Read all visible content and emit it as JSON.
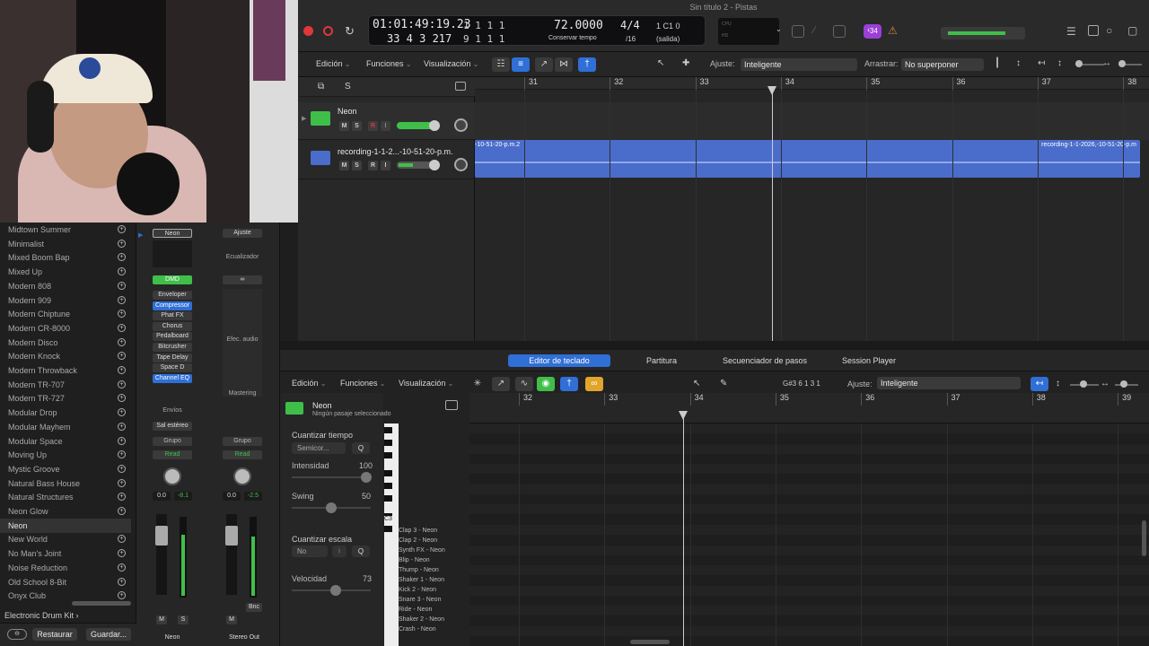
{
  "window": {
    "title": "Sin título 2 - Pistas"
  },
  "lcd": {
    "time": "01:01:49:19.23",
    "time_sub": "1 1 1 1",
    "bars": "33 4 3 217",
    "bars_sub": "9 1 1 1",
    "tempo": "72.0000",
    "tempo_label": "Conservar tempo",
    "sig": "4/4",
    "div": "/16",
    "key": "1 C1 0",
    "key_label": "(salida)",
    "cpu": "CPU",
    "hd": "HD"
  },
  "badge": {
    "count": "¹34"
  },
  "toolbar": {
    "edicion": "Edición",
    "funciones": "Funciones",
    "visualizacion": "Visualización",
    "ajuste_label": "Ajuste:",
    "ajuste_value": "Inteligente",
    "arrastrar_label": "Arrastrar:",
    "arrastrar_value": "No superponer"
  },
  "ruler": [
    "31",
    "32",
    "33",
    "34",
    "35",
    "36",
    "37",
    "38"
  ],
  "tracks": [
    {
      "name": "Neon",
      "m": "M",
      "s": "S",
      "r": "R",
      "i": "I"
    },
    {
      "name": "recording-1-1-2...-10-51-20-p.m.",
      "m": "M",
      "s": "S",
      "r": "R",
      "i": "I"
    }
  ],
  "region": {
    "left_name": "-10-51-20-p.m.2",
    "right_name": "recording-1-1-2026,-10-51-20-p.m"
  },
  "library": {
    "items": [
      "Midtown Summer",
      "Minimalist",
      "Mixed Boom Bap",
      "Mixed Up",
      "Modern 808",
      "Modern 909",
      "Modern Chiptune",
      "Modern CR-8000",
      "Modern Disco",
      "Modern Knock",
      "Modern Throwback",
      "Modern TR-707",
      "Modern TR-727",
      "Modular Drop",
      "Modular Mayhem",
      "Modular Space",
      "Moving Up",
      "Mystic Groove",
      "Natural Bass House",
      "Natural Structures",
      "Neon Glow",
      "Neon",
      "New World",
      "No Man's Joint",
      "Noise Reduction",
      "Old School 8-Bit",
      "Onyx Club"
    ],
    "selected": "Neon",
    "footer": "Electronic Drum Kit",
    "restore": "Restaurar",
    "save": "Guardar..."
  },
  "mixer": {
    "strip1": {
      "setting": "Neon",
      "dmd": "DMD",
      "plugins": [
        "Enveloper",
        "Compressor",
        "Phat FX",
        "Chorus",
        "Pedalboard",
        "Bitcrusher",
        "Tape Delay",
        "Space D",
        "Channel EQ"
      ],
      "envios": "Envíos",
      "output": "Sal estéreo",
      "group": "Grupo",
      "read": "Read",
      "pan": "0.0",
      "level": "-8.1",
      "m": "M",
      "s": "S",
      "name": "Neon"
    },
    "strip2": {
      "setting": "Ajuste",
      "eq": "Ecualizador",
      "efec": "Efec. audio",
      "mastering": "Mastering",
      "group": "Grupo",
      "read": "Read",
      "pan": "0.0",
      "level": "-2.5",
      "bnc": "Bnc",
      "m": "M",
      "name": "Stereo Out"
    }
  },
  "editor": {
    "tabs": [
      "Editor de teclado",
      "Partitura",
      "Secuenciador de pasos",
      "Session Player"
    ],
    "edicion": "Edición",
    "funciones": "Funciones",
    "visualizacion": "Visualización",
    "position": "G#3  6 1 3 1",
    "ajuste_label": "Ajuste:",
    "ajuste_value": "Inteligente",
    "ruler": [
      "32",
      "33",
      "34",
      "35",
      "36",
      "37",
      "38",
      "39"
    ],
    "region_name": "Neon",
    "region_sub": "Ningún pasaje seleccionado",
    "quant_time": "Cuantizar tiempo",
    "quant_value": "Semicor...",
    "q": "Q",
    "intensidad": "Intensidad",
    "intensidad_val": "100",
    "swing": "Swing",
    "swing_val": "50",
    "quant_scale": "Cuantizar escala",
    "scale_value": "No",
    "velocidad": "Velocidad",
    "velocidad_val": "73",
    "c3": "C3",
    "drums": [
      "Clap 3 - Neon",
      "Clap 2 - Neon",
      "Synth FX - Neon",
      "Blip - Neon",
      "Thump - Neon",
      "Shaker 1 - Neon",
      "Kick 2 - Neon",
      "Snare 3 - Neon",
      "Ride - Neon",
      "Shaker 2 - Neon",
      "Crash - Neon"
    ]
  },
  "colors": {
    "accent": "#2f6fd6",
    "region": "#4a6dcb",
    "record": "#e0373a",
    "green": "#3fbf4a"
  }
}
